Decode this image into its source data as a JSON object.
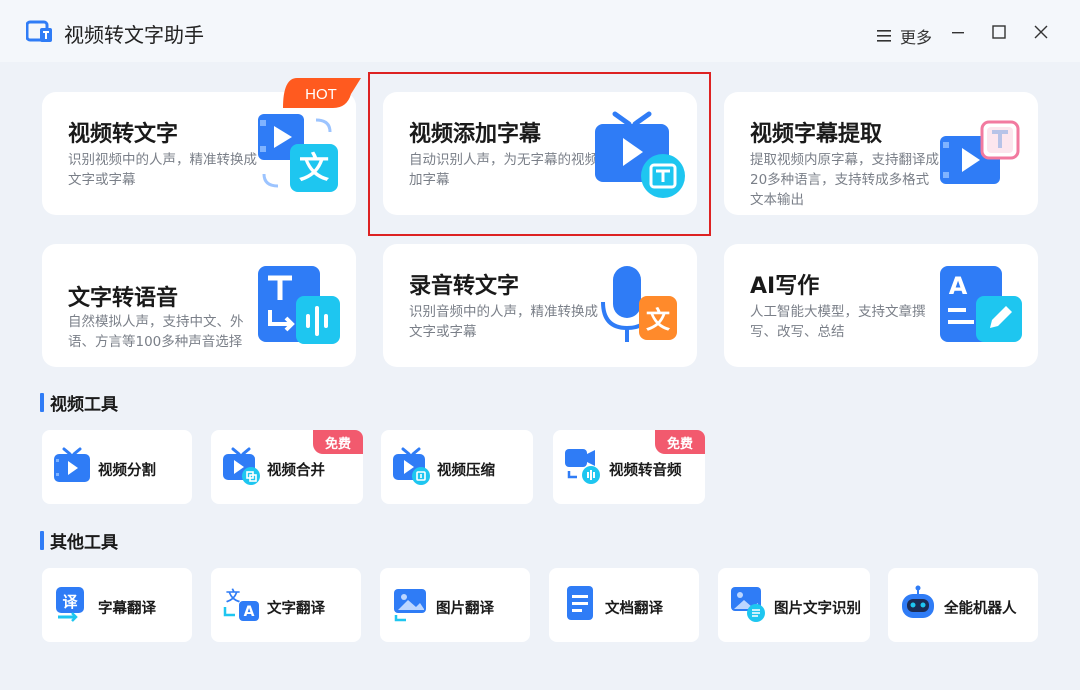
{
  "window": {
    "title": "视频转文字助手",
    "more_label": "更多"
  },
  "colors": {
    "accent": "#2f7cf6",
    "hot": "#ff5a1f",
    "free_badge": "#f25a6e",
    "highlight_border": "#d22222"
  },
  "features": [
    {
      "title": "视频转文字",
      "desc": "识别视频中的人声，精准转换成文字或字幕",
      "icon": "video-to-text-icon",
      "badge": "HOT"
    },
    {
      "title": "视频添加字幕",
      "desc": "自动识别人声，为无字幕的视频加字幕",
      "icon": "tv-subtitle-icon"
    },
    {
      "title": "视频字幕提取",
      "desc": "提取视频内原字幕，支持翻译成20多种语言，支持转成多格式文本输出",
      "icon": "subtitle-extract-icon"
    },
    {
      "title": "文字转语音",
      "desc": "自然模拟人声，支持中文、外语、方言等100多种声音选择",
      "icon": "text-to-speech-icon"
    },
    {
      "title": "录音转文字",
      "desc": "识别音频中的人声，精准转换成文字或字幕",
      "icon": "microphone-icon"
    },
    {
      "title": "AI写作",
      "desc": "人工智能大模型，支持文章撰写、改写、总结",
      "icon": "ai-writing-icon"
    }
  ],
  "video_tools": {
    "title": "视频工具",
    "items": [
      {
        "label": "视频分割",
        "icon": "video-split-icon"
      },
      {
        "label": "视频合并",
        "icon": "video-merge-icon",
        "badge": "免费"
      },
      {
        "label": "视频压缩",
        "icon": "video-compress-icon"
      },
      {
        "label": "视频转音频",
        "icon": "video-to-audio-icon",
        "badge": "免费"
      }
    ]
  },
  "other_tools": {
    "title": "其他工具",
    "items": [
      {
        "label": "字幕翻译",
        "icon": "subtitle-translate-icon"
      },
      {
        "label": "文字翻译",
        "icon": "text-translate-icon"
      },
      {
        "label": "图片翻译",
        "icon": "image-translate-icon"
      },
      {
        "label": "文档翻译",
        "icon": "document-translate-icon"
      },
      {
        "label": "图片文字识别",
        "icon": "image-ocr-icon"
      },
      {
        "label": "全能机器人",
        "icon": "robot-icon"
      }
    ]
  }
}
